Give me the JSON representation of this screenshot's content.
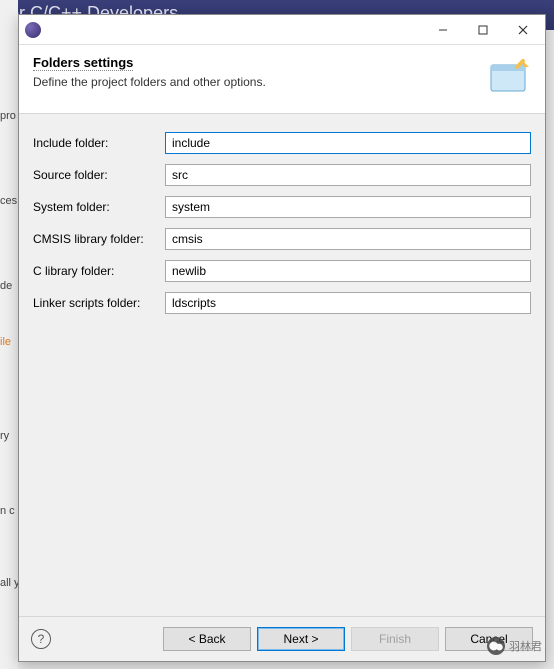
{
  "background": {
    "header_text": "for C/C++ Developers",
    "sidebar_fragments": {
      "a": "pro",
      "b": "ces",
      "c": "de",
      "d": "ile",
      "e": "ry",
      "f": "n c",
      "g": "all y"
    }
  },
  "dialog": {
    "header": {
      "title": "Folders settings",
      "description": "Define the project folders and other options."
    },
    "fields": {
      "include": {
        "label": "Include folder:",
        "value": "include"
      },
      "source": {
        "label": "Source folder:",
        "value": "src"
      },
      "system": {
        "label": "System folder:",
        "value": "system"
      },
      "cmsis": {
        "label": "CMSIS library folder:",
        "value": "cmsis"
      },
      "clib": {
        "label": "C library folder:",
        "value": "newlib"
      },
      "linker": {
        "label": "Linker scripts folder:",
        "value": "ldscripts"
      }
    },
    "buttons": {
      "back": "< Back",
      "next": "Next >",
      "finish": "Finish",
      "cancel": "Cancel"
    }
  },
  "watermark": "羽林君"
}
